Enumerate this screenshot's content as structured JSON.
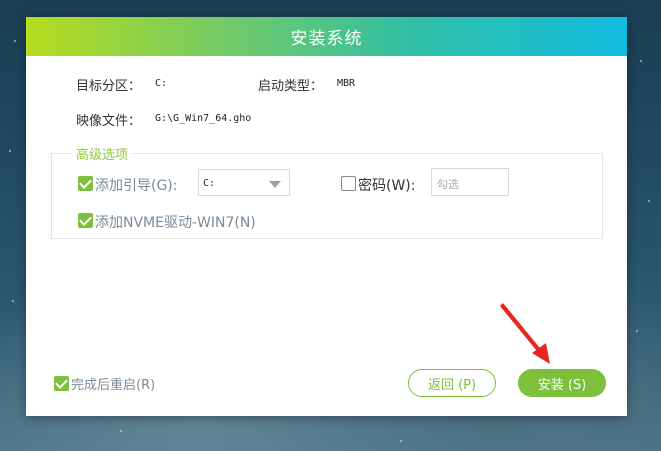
{
  "dialog": {
    "title": "安装系统"
  },
  "info": {
    "target_label": "目标分区：",
    "target_value": "C:",
    "boot_label": "启动类型：",
    "boot_value": "MBR",
    "image_label": "映像文件：",
    "image_value": "G:\\G_Win7_64.gho"
  },
  "advanced": {
    "legend": "高级选项",
    "add_boot_label": "添加引导(G):",
    "add_boot_checked": true,
    "boot_drive": "C:",
    "password_label": "密码(W):",
    "password_checked": false,
    "password_placeholder": "勾选",
    "nvme_label": "添加NVME驱动-WIN7(N)",
    "nvme_checked": true
  },
  "footer": {
    "reboot_label": "完成后重启(R)",
    "reboot_checked": true,
    "back_label": "返回 (P)",
    "install_label": "安装 (S)"
  },
  "colors": {
    "accent_green": "#7cc03c",
    "title_gradient": [
      "#b6dc1d",
      "#12bce1"
    ],
    "arrow_red": "#e8251e"
  },
  "icons": {
    "arrow": "red-pointer-arrow-icon",
    "select_caret": "caret-down-icon"
  }
}
